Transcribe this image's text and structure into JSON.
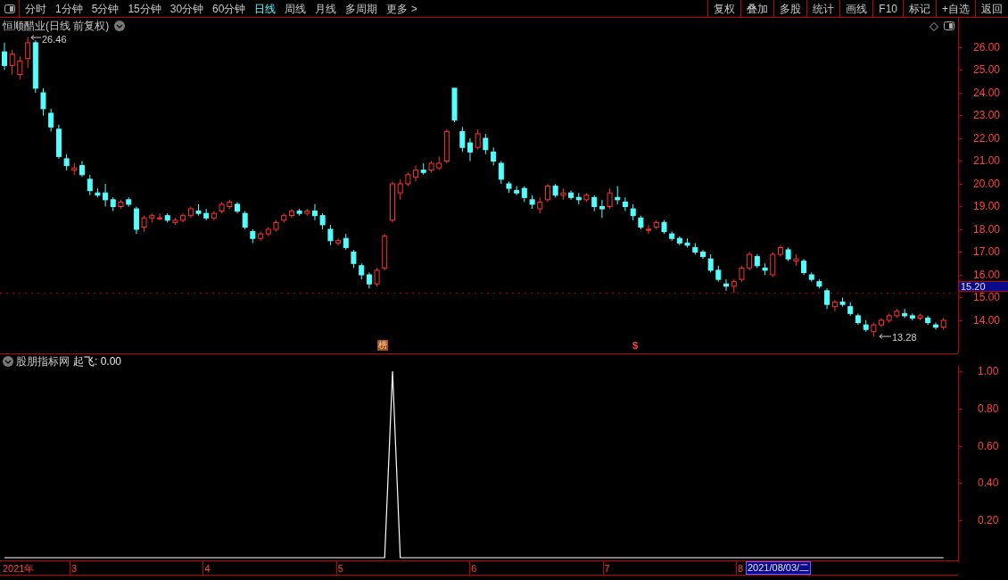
{
  "toolbar": {
    "periods": [
      {
        "label": "分时",
        "selected": false
      },
      {
        "label": "1分钟",
        "selected": false
      },
      {
        "label": "5分钟",
        "selected": false
      },
      {
        "label": "15分钟",
        "selected": false
      },
      {
        "label": "30分钟",
        "selected": false
      },
      {
        "label": "60分钟",
        "selected": false
      },
      {
        "label": "日线",
        "selected": true
      },
      {
        "label": "周线",
        "selected": false
      },
      {
        "label": "月线",
        "selected": false
      },
      {
        "label": "多周期",
        "selected": false
      },
      {
        "label": "更多 >",
        "selected": false
      }
    ],
    "buttons": [
      "复权",
      "叠加",
      "多股",
      "统计",
      "画线",
      "F10",
      "标记",
      "+自选",
      "返回"
    ]
  },
  "main_chart": {
    "title": "恒顺醋业(日线 前复权)",
    "high_label": "26.46",
    "low_label": "13.28",
    "markers": [
      {
        "text": "榜",
        "kind": "badge"
      },
      {
        "text": "$",
        "kind": "symbol"
      }
    ],
    "chart_data": {
      "type": "candlestick",
      "x": [
        2.498,
        2.556,
        2.614,
        2.673,
        2.731,
        2.789,
        2.847,
        2.906,
        2.964,
        3.022,
        3.08,
        3.139,
        3.197,
        3.255,
        3.313,
        3.371,
        3.43,
        3.488,
        3.546,
        3.604,
        3.663,
        3.721,
        3.779,
        3.837,
        3.896,
        3.954,
        4.012,
        4.07,
        4.128,
        4.187,
        4.245,
        4.303,
        4.361,
        4.42,
        4.478,
        4.536,
        4.594,
        4.653,
        4.711,
        4.769,
        4.827,
        4.885,
        4.944,
        5.002,
        5.06,
        5.118,
        5.177,
        5.235,
        5.293,
        5.351,
        5.41,
        5.468,
        5.526,
        5.584,
        5.642,
        5.701,
        5.759,
        5.817,
        5.875,
        5.934,
        5.992,
        6.05,
        6.108,
        6.167,
        6.225,
        6.283,
        6.341,
        6.399,
        6.458,
        6.516,
        6.574,
        6.632,
        6.691,
        6.749,
        6.807,
        6.865,
        6.924,
        6.982,
        7.04,
        7.098,
        7.156,
        7.215,
        7.273,
        7.331,
        7.389,
        7.448,
        7.506,
        7.564,
        7.622,
        7.681,
        7.739,
        7.797,
        7.855,
        7.913,
        7.972,
        8.03,
        8.088,
        8.146,
        8.205,
        8.263,
        8.321,
        8.379,
        8.438,
        8.496,
        8.554,
        8.612,
        8.67,
        8.729,
        8.787,
        8.845,
        8.903,
        8.962,
        9.02,
        9.078,
        9.136,
        9.194,
        9.253,
        9.311,
        9.369,
        9.427,
        9.486,
        9.544
      ],
      "ohlc": [
        [
          25.8,
          26.2,
          25.0,
          25.2
        ],
        [
          25.2,
          25.9,
          24.8,
          25.7
        ],
        [
          24.8,
          25.6,
          24.6,
          25.4
        ],
        [
          25.5,
          26.46,
          25.1,
          26.2
        ],
        [
          26.2,
          26.3,
          24.0,
          24.2
        ],
        [
          24.0,
          24.2,
          23.0,
          23.3
        ],
        [
          23.1,
          23.3,
          22.3,
          22.5
        ],
        [
          22.4,
          22.6,
          21.1,
          21.2
        ],
        [
          21.1,
          21.3,
          20.6,
          20.8
        ],
        [
          20.6,
          20.9,
          20.4,
          20.7
        ],
        [
          20.8,
          21.0,
          20.3,
          20.4
        ],
        [
          20.2,
          20.4,
          19.5,
          19.7
        ],
        [
          19.6,
          19.8,
          19.4,
          19.5
        ],
        [
          19.6,
          20.0,
          19.0,
          19.3
        ],
        [
          19.3,
          19.4,
          18.8,
          19.0
        ],
        [
          19.0,
          19.3,
          18.9,
          19.2
        ],
        [
          19.3,
          19.4,
          19.0,
          19.1
        ],
        [
          18.9,
          19.0,
          17.8,
          18.0
        ],
        [
          18.1,
          18.6,
          17.9,
          18.5
        ],
        [
          18.5,
          18.7,
          18.3,
          18.6
        ],
        [
          18.5,
          18.7,
          18.4,
          18.5
        ],
        [
          18.6,
          18.7,
          18.3,
          18.4
        ],
        [
          18.3,
          18.5,
          18.2,
          18.4
        ],
        [
          18.4,
          18.7,
          18.3,
          18.6
        ],
        [
          18.6,
          19.0,
          18.5,
          18.9
        ],
        [
          18.8,
          19.1,
          18.6,
          18.7
        ],
        [
          18.7,
          18.9,
          18.4,
          18.5
        ],
        [
          18.5,
          18.8,
          18.4,
          18.7
        ],
        [
          18.8,
          19.2,
          18.7,
          19.1
        ],
        [
          19.0,
          19.3,
          18.9,
          19.2
        ],
        [
          19.1,
          19.2,
          18.7,
          18.8
        ],
        [
          18.7,
          18.8,
          18.0,
          18.1
        ],
        [
          17.9,
          18.0,
          17.4,
          17.6
        ],
        [
          17.6,
          17.9,
          17.5,
          17.8
        ],
        [
          17.8,
          18.1,
          17.7,
          18.0
        ],
        [
          18.0,
          18.4,
          17.9,
          18.3
        ],
        [
          18.4,
          18.7,
          18.3,
          18.6
        ],
        [
          18.6,
          18.9,
          18.5,
          18.8
        ],
        [
          18.8,
          18.9,
          18.6,
          18.7
        ],
        [
          18.7,
          18.9,
          18.6,
          18.8
        ],
        [
          18.8,
          19.1,
          18.4,
          18.6
        ],
        [
          18.6,
          18.7,
          18.0,
          18.2
        ],
        [
          18.0,
          18.2,
          17.3,
          17.5
        ],
        [
          17.4,
          17.6,
          17.3,
          17.5
        ],
        [
          17.6,
          17.8,
          17.1,
          17.2
        ],
        [
          17.0,
          17.1,
          16.3,
          16.5
        ],
        [
          16.4,
          16.5,
          15.8,
          16.0
        ],
        [
          16.0,
          16.1,
          15.4,
          15.6
        ],
        [
          15.6,
          16.3,
          15.5,
          16.2
        ],
        [
          16.3,
          17.8,
          16.2,
          17.7
        ],
        [
          18.4,
          20.1,
          18.3,
          20.0
        ],
        [
          19.6,
          20.2,
          19.3,
          20.0
        ],
        [
          20.0,
          20.5,
          19.9,
          20.4
        ],
        [
          20.3,
          20.8,
          20.1,
          20.6
        ],
        [
          20.6,
          20.9,
          20.4,
          20.5
        ],
        [
          20.6,
          21.0,
          20.5,
          20.9
        ],
        [
          20.7,
          21.2,
          20.6,
          20.9
        ],
        [
          21.0,
          22.4,
          20.9,
          22.3
        ],
        [
          24.2,
          24.2,
          22.7,
          22.8
        ],
        [
          22.3,
          22.5,
          21.4,
          21.6
        ],
        [
          21.8,
          22.0,
          21.0,
          21.4
        ],
        [
          21.6,
          22.4,
          21.5,
          22.2
        ],
        [
          22.0,
          22.2,
          21.3,
          21.5
        ],
        [
          21.4,
          21.6,
          20.8,
          21.0
        ],
        [
          20.9,
          21.0,
          20.0,
          20.2
        ],
        [
          20.0,
          20.1,
          19.6,
          19.8
        ],
        [
          19.7,
          19.9,
          19.5,
          19.6
        ],
        [
          19.8,
          19.9,
          19.2,
          19.4
        ],
        [
          19.3,
          19.5,
          18.9,
          19.1
        ],
        [
          18.9,
          19.4,
          18.7,
          19.2
        ],
        [
          19.3,
          20.0,
          19.2,
          19.9
        ],
        [
          19.9,
          20.0,
          19.4,
          19.5
        ],
        [
          19.5,
          19.8,
          19.3,
          19.6
        ],
        [
          19.6,
          19.7,
          19.3,
          19.4
        ],
        [
          19.4,
          19.6,
          19.1,
          19.3
        ],
        [
          19.3,
          19.6,
          19.2,
          19.5
        ],
        [
          19.4,
          19.5,
          18.8,
          19.0
        ],
        [
          19.0,
          19.3,
          18.5,
          18.9
        ],
        [
          19.0,
          19.8,
          18.9,
          19.6
        ],
        [
          19.4,
          19.9,
          19.1,
          19.3
        ],
        [
          19.2,
          19.4,
          18.8,
          19.0
        ],
        [
          18.9,
          19.1,
          18.4,
          18.6
        ],
        [
          18.5,
          18.6,
          18.0,
          18.1
        ],
        [
          18.0,
          18.2,
          17.8,
          18.0
        ],
        [
          18.1,
          18.4,
          18.0,
          18.3
        ],
        [
          18.3,
          18.4,
          17.8,
          17.9
        ],
        [
          17.8,
          17.9,
          17.5,
          17.6
        ],
        [
          17.6,
          17.7,
          17.3,
          17.4
        ],
        [
          17.4,
          17.6,
          17.2,
          17.3
        ],
        [
          17.2,
          17.4,
          16.9,
          17.0
        ],
        [
          17.0,
          17.1,
          16.7,
          16.8
        ],
        [
          16.7,
          16.9,
          16.1,
          16.2
        ],
        [
          16.2,
          16.4,
          15.7,
          15.8
        ],
        [
          15.6,
          15.8,
          15.3,
          15.5
        ],
        [
          15.5,
          15.8,
          15.2,
          15.7
        ],
        [
          15.8,
          16.4,
          15.7,
          16.3
        ],
        [
          16.3,
          17.0,
          16.2,
          16.9
        ],
        [
          16.8,
          16.9,
          16.3,
          16.4
        ],
        [
          16.3,
          16.5,
          16.0,
          16.2
        ],
        [
          16.0,
          17.0,
          15.9,
          16.9
        ],
        [
          16.9,
          17.3,
          16.8,
          17.2
        ],
        [
          17.1,
          17.2,
          16.6,
          16.7
        ],
        [
          16.6,
          16.9,
          16.4,
          16.7
        ],
        [
          16.6,
          16.7,
          16.0,
          16.1
        ],
        [
          16.0,
          16.1,
          15.7,
          15.8
        ],
        [
          15.7,
          15.8,
          15.4,
          15.5
        ],
        [
          15.3,
          15.4,
          14.5,
          14.7
        ],
        [
          14.6,
          14.9,
          14.4,
          14.8
        ],
        [
          14.8,
          15.0,
          14.6,
          14.7
        ],
        [
          14.6,
          14.8,
          14.2,
          14.3
        ],
        [
          14.2,
          14.3,
          13.8,
          13.9
        ],
        [
          13.8,
          14.0,
          13.5,
          13.6
        ],
        [
          13.5,
          13.9,
          13.28,
          13.8
        ],
        [
          13.8,
          14.1,
          13.7,
          14.0
        ],
        [
          14.0,
          14.3,
          13.9,
          14.2
        ],
        [
          14.2,
          14.5,
          14.1,
          14.4
        ],
        [
          14.3,
          14.5,
          14.1,
          14.2
        ],
        [
          14.2,
          14.3,
          14.0,
          14.1
        ],
        [
          14.1,
          14.3,
          14.0,
          14.2
        ],
        [
          14.1,
          14.2,
          13.8,
          13.9
        ],
        [
          13.8,
          13.9,
          13.6,
          13.7
        ],
        [
          13.7,
          14.1,
          13.6,
          14.0
        ]
      ],
      "xlim": [
        2.4645,
        9.64
      ],
      "ylim": [
        12.549,
        27.294
      ],
      "ref_lines": [
        {
          "axis": "y",
          "value": 15.2,
          "label": "15.20"
        }
      ],
      "yticks": [
        {
          "value": 26,
          "label": "26.00"
        },
        {
          "value": 25,
          "label": "25.00"
        },
        {
          "value": 24,
          "label": "24.00"
        },
        {
          "value": 23,
          "label": "23.00"
        },
        {
          "value": 22,
          "label": "22.00"
        },
        {
          "value": 21,
          "label": "21.00"
        },
        {
          "value": 20,
          "label": "20.00"
        },
        {
          "value": 19,
          "label": "19.00"
        },
        {
          "value": 18,
          "label": "18.00"
        },
        {
          "value": 17,
          "label": "17.00"
        },
        {
          "value": 16,
          "label": "16.00"
        },
        {
          "value": 15,
          "label": "15.00"
        },
        {
          "value": 14,
          "label": "14.00"
        }
      ]
    }
  },
  "indicator": {
    "name": "股朋指标网",
    "reading": ": 0.00",
    "chart_data": {
      "type": "line",
      "x": [
        2.498,
        2.556,
        2.614,
        2.673,
        2.731,
        2.789,
        2.847,
        2.906,
        2.964,
        3.022,
        3.08,
        3.139,
        3.197,
        3.255,
        3.313,
        3.371,
        3.43,
        3.488,
        3.546,
        3.604,
        3.663,
        3.721,
        3.779,
        3.837,
        3.896,
        3.954,
        4.012,
        4.07,
        4.128,
        4.187,
        4.245,
        4.303,
        4.361,
        4.42,
        4.478,
        4.536,
        4.594,
        4.653,
        4.711,
        4.769,
        4.827,
        4.885,
        4.944,
        5.002,
        5.06,
        5.118,
        5.177,
        5.235,
        5.293,
        5.351,
        5.41,
        5.468,
        5.526,
        5.584,
        5.642,
        5.701,
        5.759,
        5.817,
        5.875,
        5.934,
        5.992,
        6.05,
        6.108,
        6.167,
        6.225,
        6.283,
        6.341,
        6.399,
        6.458,
        6.516,
        6.574,
        6.632,
        6.691,
        6.749,
        6.807,
        6.865,
        6.924,
        6.982,
        7.04,
        7.098,
        7.156,
        7.215,
        7.273,
        7.331,
        7.389,
        7.448,
        7.506,
        7.564,
        7.622,
        7.681,
        7.739,
        7.797,
        7.855,
        7.913,
        7.972,
        8.03,
        8.088,
        8.146,
        8.205,
        8.263,
        8.321,
        8.379,
        8.438,
        8.496,
        8.554,
        8.612,
        8.67,
        8.729,
        8.787,
        8.845,
        8.903,
        8.962,
        9.02,
        9.078,
        9.136,
        9.194,
        9.253,
        9.311,
        9.369,
        9.427,
        9.486,
        9.544
      ],
      "series": [
        {
          "name": "起飞",
          "color": "#ffffff",
          "values": [
            0,
            0,
            0,
            0,
            0,
            0,
            0,
            0,
            0,
            0,
            0,
            0,
            0,
            0,
            0,
            0,
            0,
            0,
            0,
            0,
            0,
            0,
            0,
            0,
            0,
            0,
            0,
            0,
            0,
            0,
            0,
            0,
            0,
            0,
            0,
            0,
            0,
            0,
            0,
            0,
            0,
            0,
            0,
            0,
            0,
            0,
            0,
            0,
            0,
            0,
            1,
            0,
            0,
            0,
            0,
            0,
            0,
            0,
            0,
            0,
            0,
            0,
            0,
            0,
            0,
            0,
            0,
            0,
            0,
            0,
            0,
            0,
            0,
            0,
            0,
            0,
            0,
            0,
            0,
            0,
            0,
            0,
            0,
            0,
            0,
            0,
            0,
            0,
            0,
            0,
            0,
            0,
            0,
            0,
            0,
            0,
            0,
            0,
            0,
            0,
            0,
            0,
            0,
            0,
            0,
            0,
            0,
            0,
            0,
            0,
            0,
            0,
            0,
            0,
            0,
            0,
            0,
            0,
            0,
            0,
            0,
            0
          ]
        }
      ],
      "xlim": [
        2.4645,
        9.64
      ],
      "ylim": [
        -0.0144,
        1.0287
      ],
      "xticks": [
        {
          "value": 3,
          "label": "3"
        },
        {
          "value": 4,
          "label": "4"
        },
        {
          "value": 5,
          "label": "5"
        },
        {
          "value": 6,
          "label": "6"
        },
        {
          "value": 7,
          "label": "7"
        },
        {
          "value": 8,
          "label": "8"
        }
      ],
      "yticks": [
        {
          "value": 1,
          "label": "1.00"
        },
        {
          "value": 0.8,
          "label": "0.80"
        },
        {
          "value": 0.6,
          "label": "0.60"
        },
        {
          "value": 0.4,
          "label": "0.40"
        },
        {
          "value": 0.2,
          "label": "0.20"
        }
      ]
    }
  },
  "time_axis": {
    "year_label": "2021年",
    "cursor_date": "2021/08/03/二"
  }
}
